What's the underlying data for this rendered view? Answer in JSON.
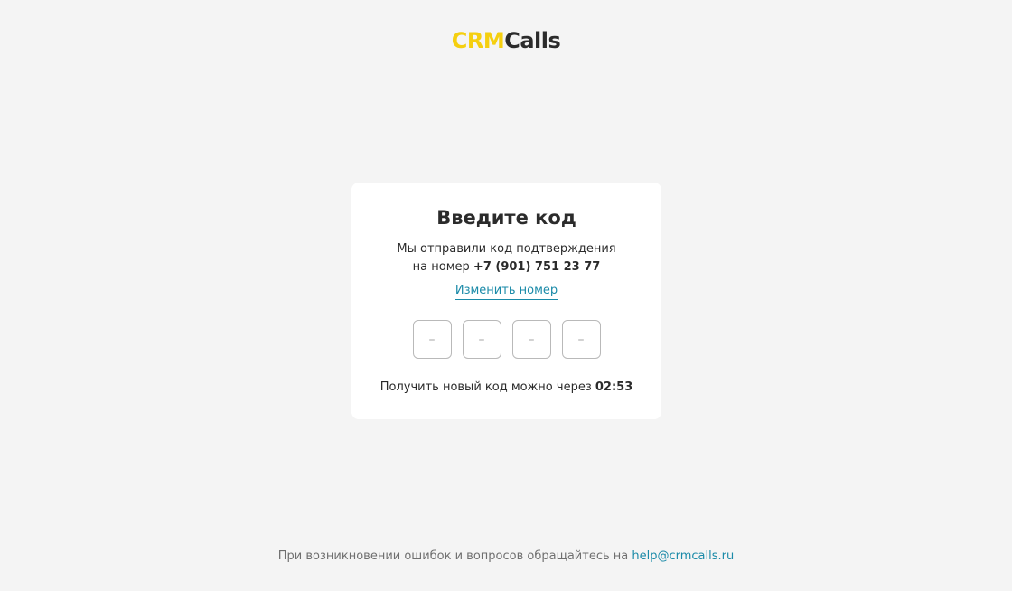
{
  "logo": {
    "part1": "CRM",
    "part2": "Calls",
    "color_part1": "#f5cf0f",
    "color_part2": "#2b2b2b"
  },
  "card": {
    "title": "Введите код",
    "desc_line1": "Мы отправили код подтверждения",
    "desc_line2_prefix": "на номер",
    "phone": "+7 (901) 751 23 77",
    "change_link": "Изменить номер",
    "code_placeholder": "–",
    "resend_prefix": "Получить новый код можно через",
    "timer": "02:53"
  },
  "footer": {
    "text": "При возникновении ошибок и вопросов обращайтесь на",
    "email": "help@crmcalls.ru"
  },
  "colors": {
    "background": "#f4f4f4",
    "accent_link": "#1a8aa8",
    "brand_yellow": "#f5cf0f"
  }
}
